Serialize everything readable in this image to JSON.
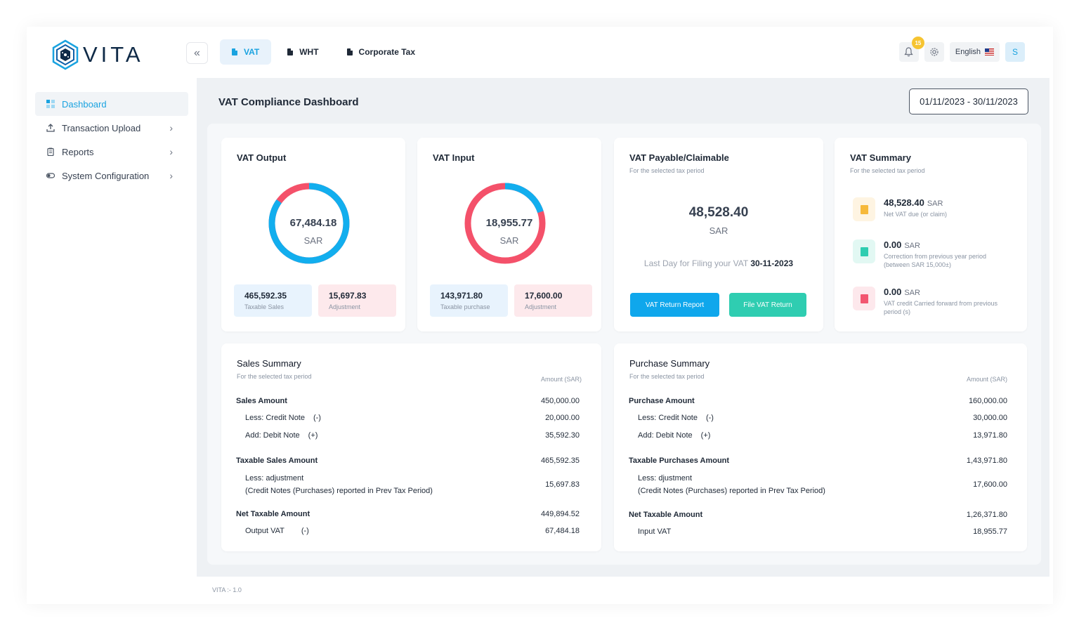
{
  "header": {
    "logo_text": "VITA",
    "tabs": [
      {
        "label": "VAT"
      },
      {
        "label": "WHT"
      },
      {
        "label": "Corporate Tax"
      }
    ],
    "notification_count": "15",
    "language": "English",
    "avatar_initial": "S"
  },
  "sidebar": {
    "items": [
      {
        "label": "Dashboard"
      },
      {
        "label": "Transaction Upload"
      },
      {
        "label": "Reports"
      },
      {
        "label": "System Configuration"
      }
    ]
  },
  "page": {
    "title": "VAT Compliance Dashboard",
    "date_range": "01/11/2023 - 30/11/2023"
  },
  "vat_output": {
    "title": "VAT Output",
    "amount": "67,484.18",
    "currency": "SAR",
    "taxable_value": "465,592.35",
    "taxable_label": "Taxable Sales",
    "adjustment_value": "15,697.83",
    "adjustment_label": "Adjustment",
    "taxable_share": 0.85
  },
  "vat_input": {
    "title": "VAT Input",
    "amount": "18,955.77",
    "currency": "SAR",
    "taxable_value": "143,971.80",
    "taxable_label": "Taxable purchase",
    "adjustment_value": "17,600.00",
    "adjustment_label": "Adjustment",
    "taxable_share": 0.2
  },
  "vat_payable": {
    "title": "VAT Payable/Claimable",
    "subtitle": "For the selected tax period",
    "amount": "48,528.40",
    "currency": "SAR",
    "last_day_label": "Last Day for Filing your VAT",
    "last_day_date": "30-11-2023",
    "report_button": "VAT Return Report",
    "file_button": "File VAT Return"
  },
  "vat_summary": {
    "title": "VAT Summary",
    "subtitle": "For the selected tax period",
    "items": [
      {
        "amount": "48,528.40",
        "currency": "SAR",
        "desc": "Net VAT due (or claim)",
        "color": "#f6b93b",
        "bg": "#fef4e2"
      },
      {
        "amount": "0.00",
        "currency": "SAR",
        "desc": "Correction from previous year period (between SAR 15,000±)",
        "color": "#2fcdb1",
        "bg": "#e2f8f3"
      },
      {
        "amount": "0.00",
        "currency": "SAR",
        "desc": "VAT credit Carried forward from previous period (s)",
        "color": "#f25670",
        "bg": "#fde8ec"
      }
    ]
  },
  "sales_summary": {
    "title": "Sales Summary",
    "subtitle": "For the selected tax period",
    "amount_header": "Amount (SAR)",
    "rows": [
      {
        "label": "Sales Amount",
        "sign": "",
        "amount": "450,000.00"
      },
      {
        "label": "Less: Credit Note",
        "sign": "(-)",
        "amount": "20,000.00"
      },
      {
        "label": "Add: Debit Note",
        "sign": "(+)",
        "amount": "35,592.30"
      },
      {
        "label": "Taxable Sales Amount",
        "sign": "",
        "amount": "465,592.35"
      },
      {
        "label": "Less: adjustment",
        "label2": "(Credit Notes (Purchases) reported in Prev Tax Period)",
        "sign": "",
        "amount": "15,697.83"
      },
      {
        "label": "Net Taxable Amount",
        "sign": "",
        "amount": "449,894.52"
      },
      {
        "label": "Output VAT",
        "sign": "(-)",
        "amount": "67,484.18"
      }
    ]
  },
  "purchase_summary": {
    "title": "Purchase Summary",
    "subtitle": "For the selected tax period",
    "amount_header": "Amount (SAR)",
    "rows": [
      {
        "label": "Purchase Amount",
        "sign": "",
        "amount": "160,000.00"
      },
      {
        "label": "Less: Credit Note",
        "sign": "(-)",
        "amount": "30,000.00"
      },
      {
        "label": "Add: Debit Note",
        "sign": "(+)",
        "amount": "13,971.80"
      },
      {
        "label": "Taxable Purchases Amount",
        "sign": "",
        "amount": "1,43,971.80"
      },
      {
        "label": "Less: djustment",
        "label2": "(Credit Notes (Purchases) reported in Prev Tax Period)",
        "sign": "",
        "amount": "17,600.00"
      },
      {
        "label": "Net Taxable Amount",
        "sign": "",
        "amount": "1,26,371.80"
      },
      {
        "label": "Input VAT",
        "sign": "",
        "amount": "18,955.77"
      }
    ]
  },
  "footer": {
    "version": "VITA :- 1.0"
  },
  "colors": {
    "accent": "#1aa3e0",
    "donut_blue": "#12aeee",
    "donut_red": "#f4516a"
  }
}
